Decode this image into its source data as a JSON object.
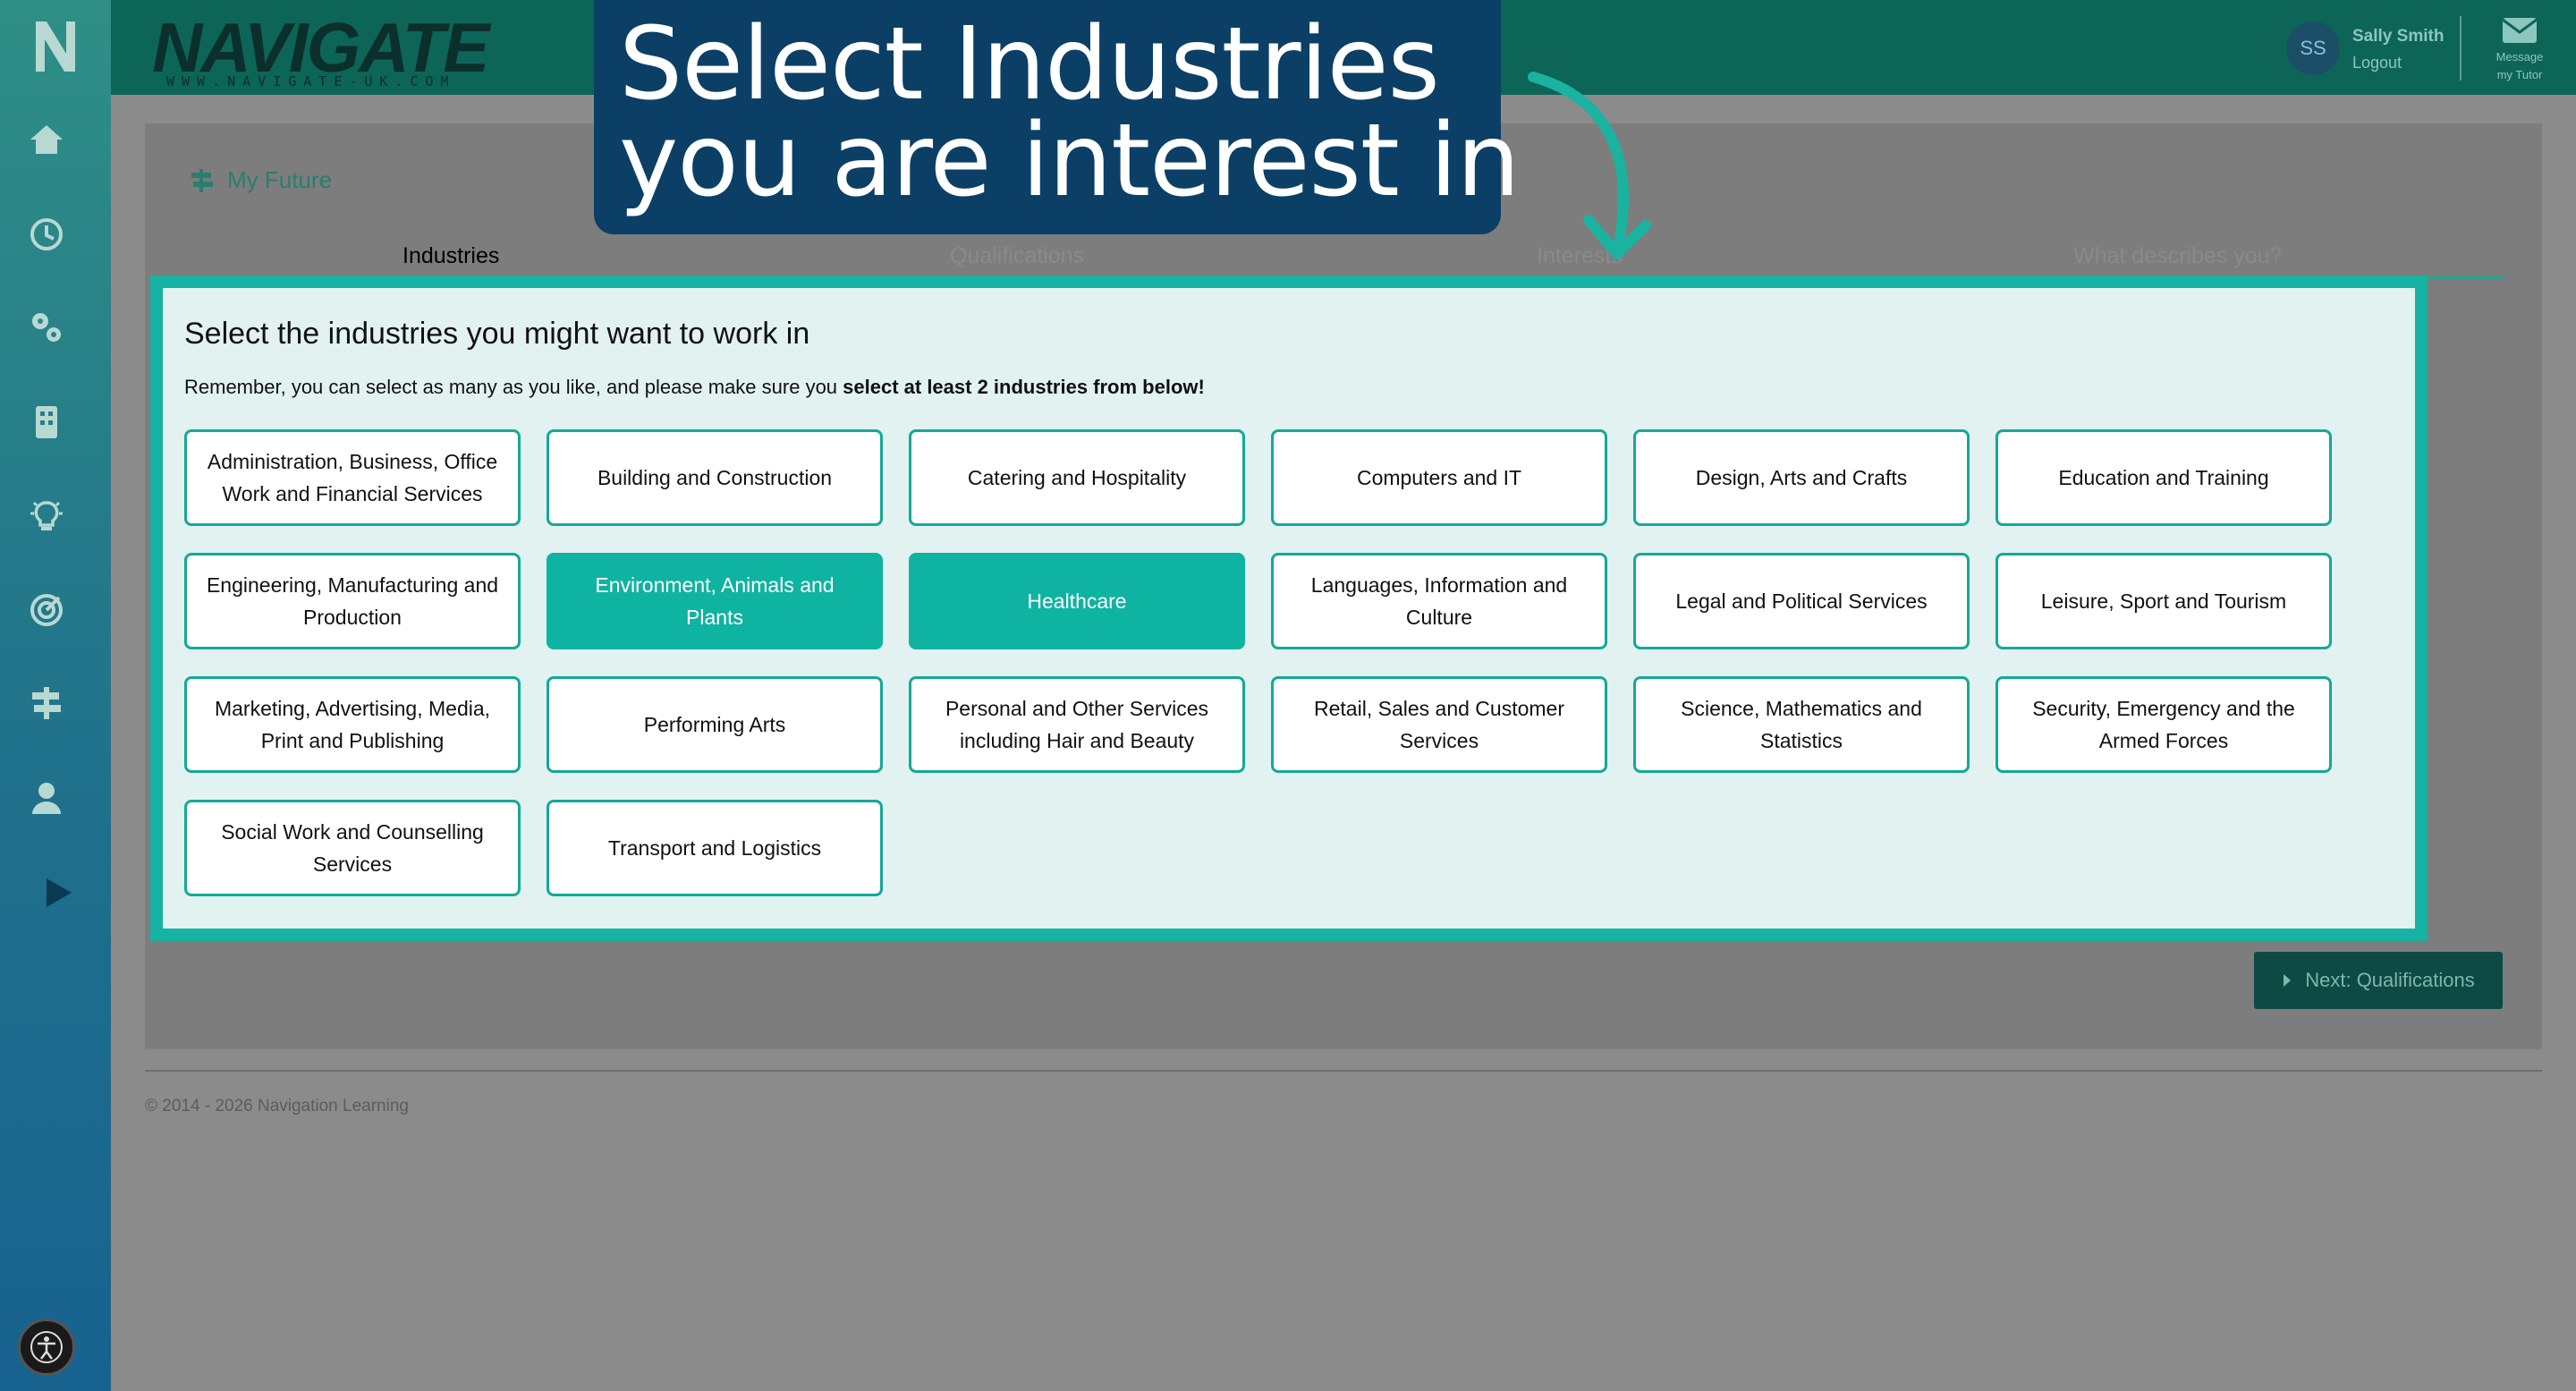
{
  "brand": {
    "word": "NAVIGATE",
    "url": "WWW.NAVIGATE-UK.COM"
  },
  "user": {
    "initials": "SS",
    "name": "Sally Smith",
    "logout": "Logout"
  },
  "message": {
    "line1": "Message",
    "line2": "my Tutor"
  },
  "breadcrumb": "My Future",
  "tabs": [
    "Industries",
    "Qualifications",
    "Interests",
    "What describes you?"
  ],
  "panel": {
    "title": "Select the industries you might want to work in",
    "note_prefix": "Remember, you can select as many as you like, and please make sure you ",
    "note_bold": "select at least 2 industries from below!"
  },
  "industries": [
    {
      "label": "Administration, Business, Office Work and Financial Services",
      "selected": false
    },
    {
      "label": "Building and Construction",
      "selected": false
    },
    {
      "label": "Catering and Hospitality",
      "selected": false
    },
    {
      "label": "Computers and IT",
      "selected": false
    },
    {
      "label": "Design, Arts and Crafts",
      "selected": false
    },
    {
      "label": "Education and Training",
      "selected": false
    },
    {
      "label": "Engineering, Manufacturing and Production",
      "selected": false
    },
    {
      "label": "Environment, Animals and Plants",
      "selected": true
    },
    {
      "label": "Healthcare",
      "selected": true
    },
    {
      "label": "Languages, Information and Culture",
      "selected": false
    },
    {
      "label": "Legal and Political Services",
      "selected": false
    },
    {
      "label": "Leisure, Sport and Tourism",
      "selected": false
    },
    {
      "label": "Marketing, Advertising, Media, Print and Publishing",
      "selected": false
    },
    {
      "label": "Performing Arts",
      "selected": false
    },
    {
      "label": "Personal and Other Services including Hair and Beauty",
      "selected": false
    },
    {
      "label": "Retail, Sales and Customer Services",
      "selected": false
    },
    {
      "label": "Science, Mathematics and Statistics",
      "selected": false
    },
    {
      "label": "Security, Emergency and the Armed Forces",
      "selected": false
    },
    {
      "label": "Social Work and Counselling Services",
      "selected": false
    },
    {
      "label": "Transport and Logistics",
      "selected": false
    }
  ],
  "next_button": "Next: Qualifications",
  "copyright": "© 2014 - 2026 Navigation Learning",
  "callout": {
    "line1": "Select Industries",
    "line2": "you are interest in"
  },
  "colors": {
    "accent": "#17b3a2",
    "topbar": "#0d6557",
    "callout": "#0b3f66"
  },
  "sidebar_icons": [
    "home-icon",
    "clock-icon",
    "gears-icon",
    "building-icon",
    "lightbulb-icon",
    "target-icon",
    "signpost-icon",
    "user-icon",
    "play-icon"
  ]
}
